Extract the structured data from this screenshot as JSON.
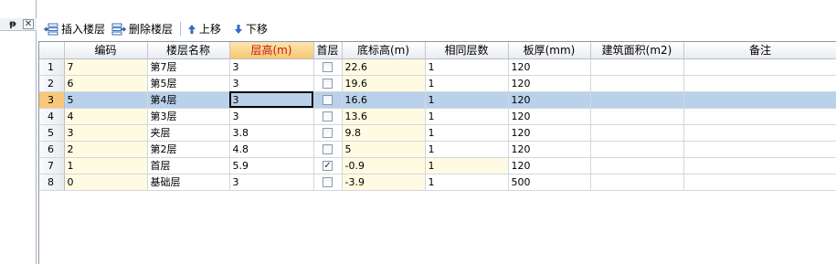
{
  "left_pane": {
    "pin_glyph": "ᵽ",
    "close_glyph": "✕"
  },
  "toolbar": {
    "insert_label": "插入楼层",
    "delete_label": "删除楼层",
    "up_label": "上移",
    "down_label": "下移"
  },
  "grid": {
    "columns": [
      "",
      "编码",
      "楼层名称",
      "层高(m)",
      "首层",
      "底标高(m)",
      "相同层数",
      "板厚(mm)",
      "建筑面积(m2)",
      "备注"
    ],
    "sorted_column": "层高(m)",
    "selected_row": 3,
    "rows": [
      {
        "n": "1",
        "code": "7",
        "name": "第7层",
        "height": "3",
        "first": false,
        "base": "22.6",
        "same": "1",
        "slab": "120",
        "area": "",
        "note": ""
      },
      {
        "n": "2",
        "code": "6",
        "name": "第5层",
        "height": "3",
        "first": false,
        "base": "19.6",
        "same": "1",
        "slab": "120",
        "area": "",
        "note": ""
      },
      {
        "n": "3",
        "code": "5",
        "name": "第4层",
        "height": "3",
        "first": false,
        "base": "16.6",
        "same": "1",
        "slab": "120",
        "area": "",
        "note": ""
      },
      {
        "n": "4",
        "code": "4",
        "name": "第3层",
        "height": "3",
        "first": false,
        "base": "13.6",
        "same": "1",
        "slab": "120",
        "area": "",
        "note": ""
      },
      {
        "n": "5",
        "code": "3",
        "name": "夹层",
        "height": "3.8",
        "first": false,
        "base": "9.8",
        "same": "1",
        "slab": "120",
        "area": "",
        "note": ""
      },
      {
        "n": "6",
        "code": "2",
        "name": "第2层",
        "height": "4.8",
        "first": false,
        "base": "5",
        "same": "1",
        "slab": "120",
        "area": "",
        "note": ""
      },
      {
        "n": "7",
        "code": "1",
        "name": "首层",
        "height": "5.9",
        "first": true,
        "base": "-0.9",
        "same": "1",
        "slab": "120",
        "area": "",
        "note": ""
      },
      {
        "n": "8",
        "code": "0",
        "name": "基础层",
        "height": "3",
        "first": false,
        "base": "-3.9",
        "same": "1",
        "slab": "500",
        "area": "",
        "note": ""
      }
    ],
    "checkbox_checked_glyph": "✓"
  }
}
